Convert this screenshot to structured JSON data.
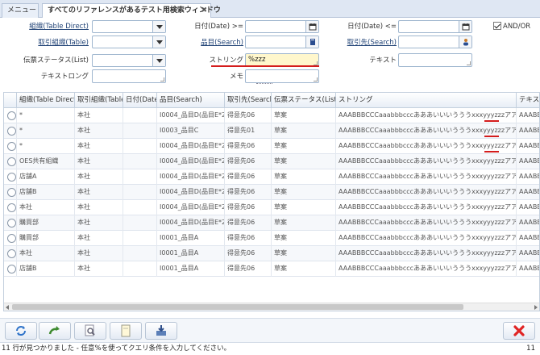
{
  "tabs": {
    "menu": "メニュー",
    "active": "すべてのリファレンスがあるテスト用検索ウィンドウ",
    "close": "✖"
  },
  "form": {
    "org_label": "組織(Table Direct)",
    "partner_org_label": "取引組織(Table)",
    "doc_status_label": "伝票ステータス(List)",
    "text_long_label": "テキストロング",
    "date_from_label": "日付(Date) >=",
    "product_label": "品目(Search)",
    "string_label": "ストリング",
    "string_value": "%zzz",
    "memo_label": "メモ",
    "date_to_label": "日付(Date) <=",
    "bpartner_label": "取引先(Search)",
    "text_label": "テキスト",
    "and_or_label": "AND/OR"
  },
  "grid": {
    "columns": [
      "組織(Table Direct)",
      "取引組織(Table)",
      "日付(Date)",
      "品目(Search)",
      "取引先(Search)",
      "伝票ステータス(List)",
      "ストリング",
      "テキス"
    ],
    "rows": [
      [
        "*",
        "本社",
        "",
        "I0004_品目D(品目E*2)",
        "得意先06",
        "草案",
        "AAABBBCCCaaabbbcccあああいいいうううxxxyyyzzzアアア",
        "AAABB"
      ],
      [
        "*",
        "本社",
        "",
        "I0003_品目C",
        "得意先01",
        "草案",
        "AAABBBCCCaaabbbcccあああいいいうううxxxyyyzzzアアア",
        "AAABB"
      ],
      [
        "*",
        "本社",
        "",
        "I0004_品目D(品目E*2)",
        "得意先06",
        "草案",
        "AAABBBCCCaaabbbcccあああいいいうううxxxyyyzzzアアア",
        "AAABB"
      ],
      [
        "OES共有組織",
        "本社",
        "",
        "I0004_品目D(品目E*2)",
        "得意先06",
        "草案",
        "AAABBBCCCaaabbbcccあああいいいうううxxxyyyzzzアアア",
        "AAABB"
      ],
      [
        "店舗A",
        "本社",
        "",
        "I0004_品目D(品目E*2)",
        "得意先06",
        "草案",
        "AAABBBCCCaaabbbcccあああいいいうううxxxyyyzzzアアア",
        "AAABB"
      ],
      [
        "店舗B",
        "本社",
        "",
        "I0004_品目D(品目E*2)",
        "得意先06",
        "草案",
        "AAABBBCCCaaabbbcccあああいいいうううxxxyyyzzzアアア",
        "AAABB"
      ],
      [
        "本社",
        "本社",
        "",
        "I0004_品目D(品目E*2)",
        "得意先06",
        "草案",
        "AAABBBCCCaaabbbcccあああいいいうううxxxyyyzzzアアア",
        "AAABB"
      ],
      [
        "購買部",
        "本社",
        "",
        "I0004_品目D(品目E*2)",
        "得意先06",
        "草案",
        "AAABBBCCCaaabbbcccあああいいいうううxxxyyyzzzアアア",
        "AAABB"
      ],
      [
        "購買部",
        "本社",
        "",
        "I0001_品目A",
        "得意先06",
        "草案",
        "AAABBBCCCaaabbbcccあああいいいうううxxxyyyzzzアアア",
        "AAABB"
      ],
      [
        "本社",
        "本社",
        "",
        "I0001_品目A",
        "得意先06",
        "草案",
        "AAABBBCCCaaabbbcccあああいいいうううxxxyyyzzzアアア",
        "AAABB"
      ],
      [
        "店舗B",
        "本社",
        "",
        "I0001_品目A",
        "得意先06",
        "草案",
        "AAABBBCCCaaabbbcccあああいいいうううxxxyyyzzzアアア",
        "AAABB"
      ]
    ]
  },
  "status": {
    "message": "11 行が見つかりました - 任意%を使ってクエリ条件を入力してください。",
    "count": "11"
  },
  "colors": {
    "highlight": "#d41c1c",
    "field_yellow": "#fff7cc",
    "cancel_red": "#e02424"
  }
}
